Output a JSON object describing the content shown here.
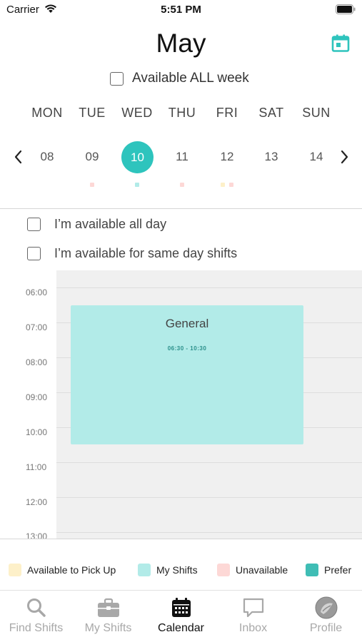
{
  "status_bar": {
    "carrier": "Carrier",
    "time": "5:51 PM"
  },
  "header": {
    "month": "May",
    "calendar_icon": "calendar-icon"
  },
  "available_all_week": {
    "label": "Available ALL week",
    "checked": false
  },
  "week": {
    "day_names": [
      "MON",
      "TUE",
      "WED",
      "THU",
      "FRI",
      "SAT",
      "SUN"
    ],
    "dates": [
      "08",
      "09",
      "10",
      "11",
      "12",
      "13",
      "14"
    ],
    "selected_date": "10"
  },
  "options": {
    "all_day": {
      "label": "I’m available all day",
      "checked": false
    },
    "same_day": {
      "label": "I’m available for same day shifts",
      "checked": false
    }
  },
  "schedule": {
    "hours": [
      "06:00",
      "07:00",
      "08:00",
      "09:00",
      "10:00",
      "11:00",
      "12:00",
      "13:00"
    ],
    "shift": {
      "name": "General",
      "time_range": "06:30 - 10:30"
    }
  },
  "legend": [
    {
      "label": "Available to Pick Up",
      "color": "#fdf0c9"
    },
    {
      "label": "My Shifts",
      "color": "#b2ebe8"
    },
    {
      "label": "Unavailable",
      "color": "#fdd8d6"
    },
    {
      "label": "Prefer",
      "color": "#3fbdb5"
    }
  ],
  "tabs": [
    {
      "label": "Find Shifts",
      "icon": "search-icon",
      "active": false
    },
    {
      "label": "My Shifts",
      "icon": "briefcase-icon",
      "active": false
    },
    {
      "label": "Calendar",
      "icon": "calendar-icon",
      "active": true
    },
    {
      "label": "Inbox",
      "icon": "chat-bubble-icon",
      "active": false
    },
    {
      "label": "Profile",
      "icon": "avatar-icon",
      "active": false
    }
  ],
  "colors": {
    "accent": "#2ec4bd",
    "shift_fill": "#b2ebe8"
  }
}
